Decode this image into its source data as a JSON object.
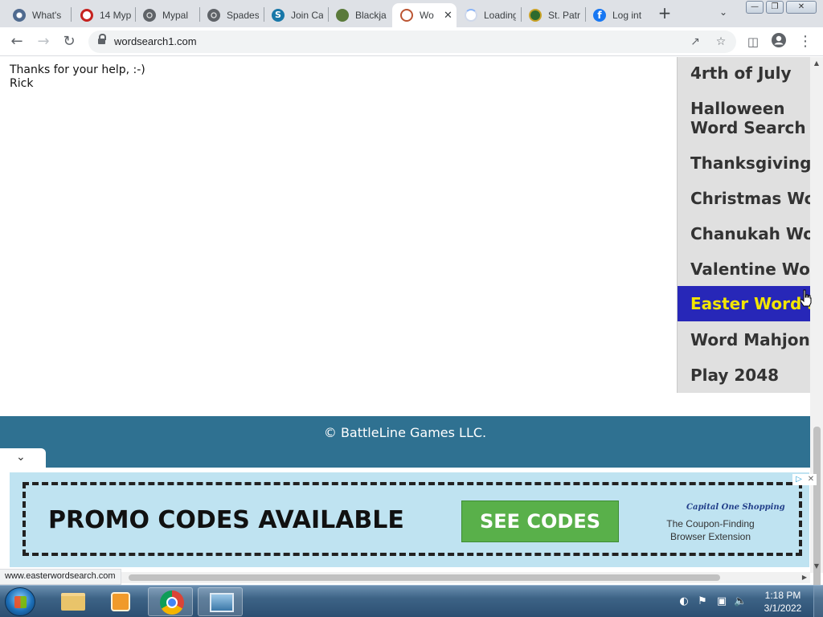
{
  "browser": {
    "tabs": [
      {
        "title": "What's",
        "icon": "chrome-icon"
      },
      {
        "title": "14 Myp",
        "icon": "red-circle-icon"
      },
      {
        "title": "Mypal",
        "icon": "globe-icon"
      },
      {
        "title": "Spades",
        "icon": "globe-icon"
      },
      {
        "title": "Join Ca",
        "icon": "skype-icon"
      },
      {
        "title": "Blackja",
        "icon": "game-icon"
      },
      {
        "title": "Wo",
        "icon": "wordsearch-icon",
        "active": true
      },
      {
        "title": "Loading",
        "icon": "loading-spinner-icon"
      },
      {
        "title": "St. Patri",
        "icon": "shamrock-icon"
      },
      {
        "title": "Log int",
        "icon": "facebook-icon"
      }
    ],
    "url": "wordsearch1.com",
    "status_url": "www.easterwordsearch.com"
  },
  "page": {
    "message_line1": "Thanks for your help, :-)",
    "message_line2": "Rick",
    "menu": [
      {
        "label": "4rth of July"
      },
      {
        "label": "Halloween Word Search"
      },
      {
        "label": "Thanksgiving Word Search"
      },
      {
        "label": "Christmas Word Search"
      },
      {
        "label": "Chanukah Word Search"
      },
      {
        "label": "Valentine Word Search"
      },
      {
        "label": "Easter Word Search",
        "active": true
      },
      {
        "label": "Word Mahjong"
      },
      {
        "label": "Play 2048"
      }
    ],
    "footer": "© BattleLine Games LLC.",
    "menu_active_bg": "#2727b8",
    "menu_active_fg": "#f2e600",
    "footer_bg": "#2f7191"
  },
  "ad": {
    "headline": "PROMO CODES AVAILABLE",
    "button": "SEE CODES",
    "brand": "Capital One Shopping",
    "tagline": "The Coupon-Finding Browser Extension",
    "background": "#bfe3f1",
    "button_color": "#59b04a"
  },
  "taskbar": {
    "time": "1:18 PM",
    "date": "3/1/2022"
  }
}
